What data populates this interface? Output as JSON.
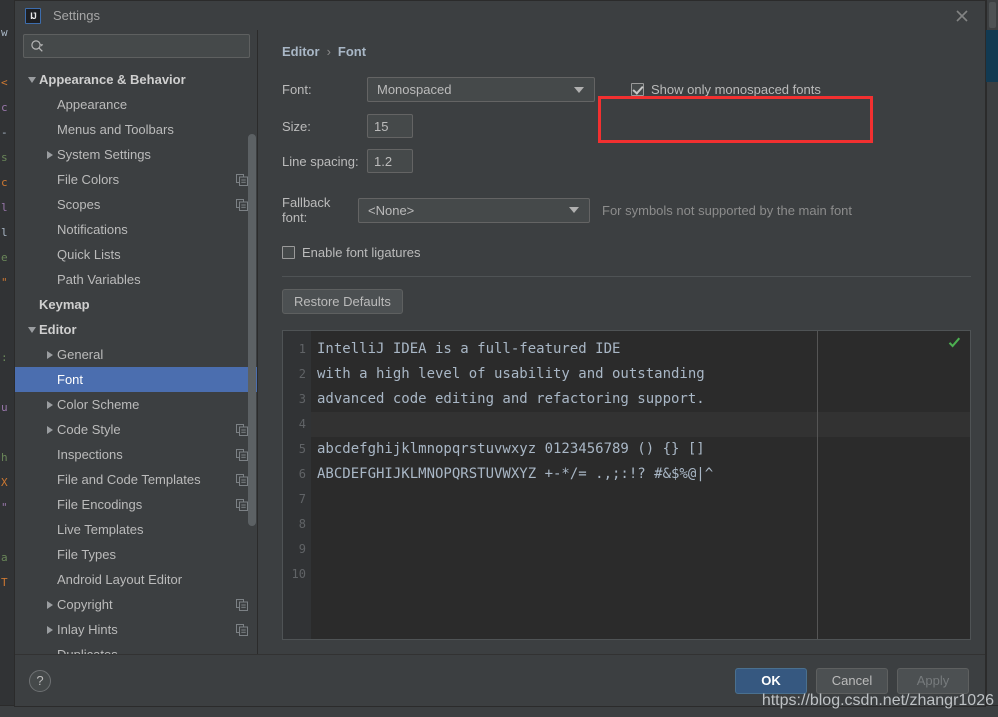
{
  "window": {
    "title": "Settings",
    "app_icon": "intellij-idea-icon",
    "close_icon": "close-icon"
  },
  "search": {
    "value": "",
    "placeholder": "",
    "icon": "search-icon"
  },
  "sidebar": {
    "items": [
      {
        "label": "Appearance & Behavior",
        "twisty": "down",
        "indent": 0,
        "bold": true,
        "copy": false,
        "selected": false
      },
      {
        "label": "Appearance",
        "twisty": "none",
        "indent": 1,
        "bold": false,
        "copy": false,
        "selected": false
      },
      {
        "label": "Menus and Toolbars",
        "twisty": "none",
        "indent": 1,
        "bold": false,
        "copy": false,
        "selected": false
      },
      {
        "label": "System Settings",
        "twisty": "right",
        "indent": 1,
        "bold": false,
        "copy": false,
        "selected": false
      },
      {
        "label": "File Colors",
        "twisty": "none",
        "indent": 1,
        "bold": false,
        "copy": true,
        "selected": false
      },
      {
        "label": "Scopes",
        "twisty": "none",
        "indent": 1,
        "bold": false,
        "copy": true,
        "selected": false
      },
      {
        "label": "Notifications",
        "twisty": "none",
        "indent": 1,
        "bold": false,
        "copy": false,
        "selected": false
      },
      {
        "label": "Quick Lists",
        "twisty": "none",
        "indent": 1,
        "bold": false,
        "copy": false,
        "selected": false
      },
      {
        "label": "Path Variables",
        "twisty": "none",
        "indent": 1,
        "bold": false,
        "copy": false,
        "selected": false
      },
      {
        "label": "Keymap",
        "twisty": "none",
        "indent": 0,
        "bold": true,
        "copy": false,
        "selected": false
      },
      {
        "label": "Editor",
        "twisty": "down",
        "indent": 0,
        "bold": true,
        "copy": false,
        "selected": false
      },
      {
        "label": "General",
        "twisty": "right",
        "indent": 1,
        "bold": false,
        "copy": false,
        "selected": false
      },
      {
        "label": "Font",
        "twisty": "none",
        "indent": 1,
        "bold": false,
        "copy": false,
        "selected": true
      },
      {
        "label": "Color Scheme",
        "twisty": "right",
        "indent": 1,
        "bold": false,
        "copy": false,
        "selected": false
      },
      {
        "label": "Code Style",
        "twisty": "right",
        "indent": 1,
        "bold": false,
        "copy": true,
        "selected": false
      },
      {
        "label": "Inspections",
        "twisty": "none",
        "indent": 1,
        "bold": false,
        "copy": true,
        "selected": false
      },
      {
        "label": "File and Code Templates",
        "twisty": "none",
        "indent": 1,
        "bold": false,
        "copy": true,
        "selected": false
      },
      {
        "label": "File Encodings",
        "twisty": "none",
        "indent": 1,
        "bold": false,
        "copy": true,
        "selected": false
      },
      {
        "label": "Live Templates",
        "twisty": "none",
        "indent": 1,
        "bold": false,
        "copy": false,
        "selected": false
      },
      {
        "label": "File Types",
        "twisty": "none",
        "indent": 1,
        "bold": false,
        "copy": false,
        "selected": false
      },
      {
        "label": "Android Layout Editor",
        "twisty": "none",
        "indent": 1,
        "bold": false,
        "copy": false,
        "selected": false
      },
      {
        "label": "Copyright",
        "twisty": "right",
        "indent": 1,
        "bold": false,
        "copy": true,
        "selected": false
      },
      {
        "label": "Inlay Hints",
        "twisty": "right",
        "indent": 1,
        "bold": false,
        "copy": true,
        "selected": false
      },
      {
        "label": "Duplicates",
        "twisty": "none",
        "indent": 1,
        "bold": false,
        "copy": false,
        "selected": false
      }
    ]
  },
  "main": {
    "breadcrumb": {
      "parent": "Editor",
      "separator": "›",
      "current": "Font"
    },
    "font": {
      "label": "Font:",
      "value": "Monospaced",
      "highlight_color": "#f23030"
    },
    "show_monospaced": {
      "label": "Show only monospaced fonts",
      "checked": true
    },
    "size": {
      "label": "Size:",
      "value": "15"
    },
    "line_spacing": {
      "label": "Line spacing:",
      "value": "1.2"
    },
    "fallback": {
      "label": "Fallback font:",
      "value": "<None>",
      "hint": "For symbols not supported by the main font"
    },
    "ligatures": {
      "label": "Enable font ligatures",
      "checked": false
    },
    "restore_defaults": "Restore Defaults"
  },
  "preview": {
    "line_numbers": [
      "1",
      "2",
      "3",
      "4",
      "5",
      "6",
      "7",
      "8",
      "9",
      "10"
    ],
    "lines": [
      "IntelliJ IDEA is a full-featured IDE",
      "with a high level of usability and outstanding",
      "advanced code editing and refactoring support.",
      "",
      "abcdefghijklmnopqrstuvwxyz 0123456789 () {} []",
      "ABCDEFGHIJKLMNOPQRSTUVWXYZ +-*/= .,;:!? #&$%@|^",
      "",
      "",
      "",
      ""
    ],
    "inspection_status_icon": "green-check-icon"
  },
  "footer": {
    "help_label": "?",
    "ok": "OK",
    "cancel": "Cancel",
    "apply": "Apply",
    "apply_disabled": true
  },
  "watermark": "https://blog.csdn.net/zhangr1026",
  "background_code_fragment": [
    "w",
    "",
    "<",
    "c",
    "-",
    "s",
    "c",
    "l",
    "l",
    "e",
    "\"",
    "",
    "",
    ":",
    "",
    "u",
    "",
    "h",
    "X",
    "\"",
    "",
    "a",
    "T"
  ]
}
